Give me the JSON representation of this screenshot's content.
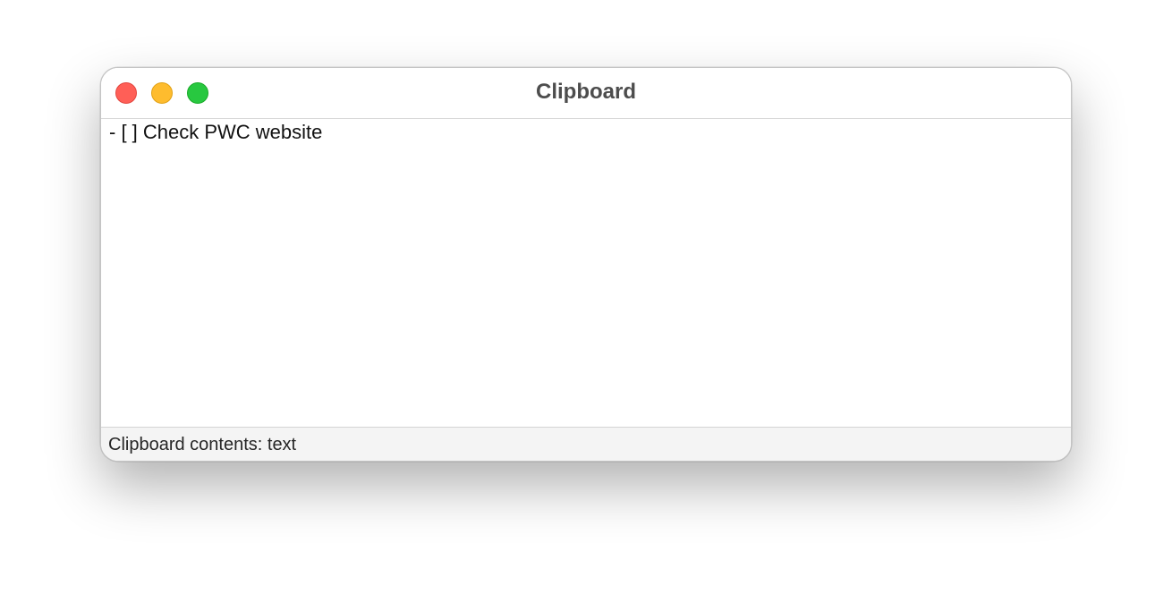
{
  "window": {
    "title": "Clipboard",
    "traffic_lights": {
      "close": "#ff5f57",
      "minimize": "#febc2e",
      "zoom": "#28c840"
    }
  },
  "content": {
    "text": "- [ ] Check PWC website"
  },
  "status": {
    "text": "Clipboard contents: text"
  }
}
